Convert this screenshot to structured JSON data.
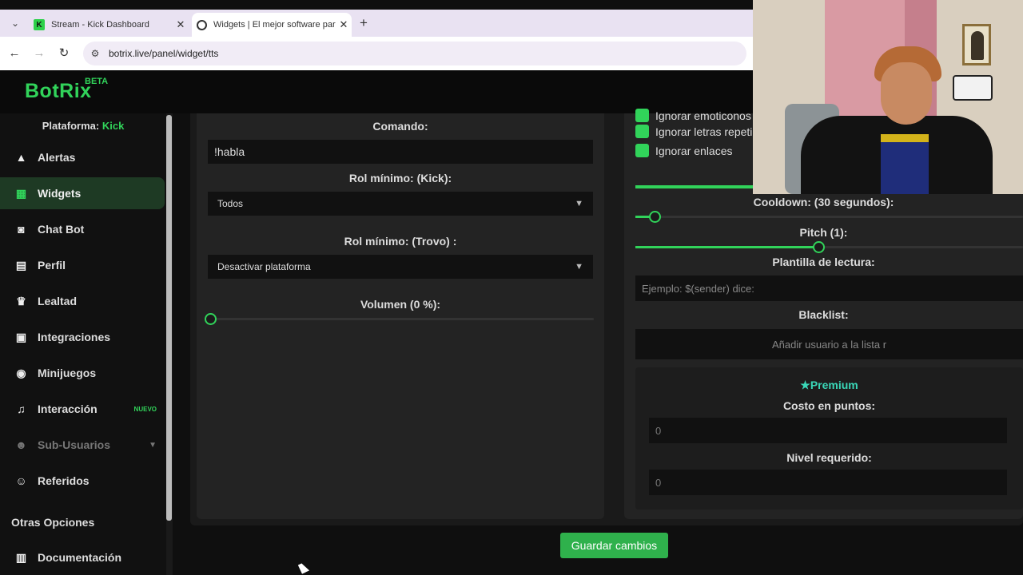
{
  "browser": {
    "tabs": [
      {
        "title": "Stream - Kick Dashboard",
        "favicon": "K"
      },
      {
        "title": "Widgets | El mejor software para",
        "favicon": ""
      }
    ],
    "url": "botrix.live/panel/widget/tts"
  },
  "app": {
    "logo": "BotRix",
    "logo_badge": "BETA",
    "platform_label": "Plataforma:",
    "platform_value": "Kick",
    "accent": "#31d35a"
  },
  "sidebar": {
    "items": [
      {
        "label": "Alertas",
        "icon": "warning-icon"
      },
      {
        "label": "Widgets",
        "icon": "grid-icon",
        "active": true
      },
      {
        "label": "Chat Bot",
        "icon": "robot-icon"
      },
      {
        "label": "Perfil",
        "icon": "id-card-icon"
      },
      {
        "label": "Lealtad",
        "icon": "trophy-icon"
      },
      {
        "label": "Integraciones",
        "icon": "puzzle-icon"
      },
      {
        "label": "Minijuegos",
        "icon": "gamepad-icon"
      },
      {
        "label": "Interacción",
        "icon": "music-icon",
        "badge": "NUEVO"
      },
      {
        "label": "Sub-Usuarios",
        "icon": "users-icon"
      },
      {
        "label": "Referidos",
        "icon": "user-group-icon"
      }
    ],
    "section_title": "Otras Opciones",
    "docs_label": "Documentación"
  },
  "left": {
    "command_label": "Comando:",
    "command_value": "!habla",
    "role_kick_label": "Rol mínimo: (Kick):",
    "role_kick_value": "Todos",
    "role_trovo_label": "Rol mínimo: (Trovo) :",
    "role_trovo_value": "Desactivar plataforma",
    "volume_label": "Volumen (0 %):",
    "volume_value": 0
  },
  "right": {
    "checks": [
      "Ignorar emoticonos",
      "Ignorar letras repetidas",
      "Ignorar enlaces"
    ],
    "cooldown_label": "Cooldown: (30 segundos):",
    "cooldown_value": 0.05,
    "pitch_label": "Pitch (1):",
    "pitch_value": 0.48,
    "template_label": "Plantilla de lectura:",
    "template_placeholder": "Ejemplo: $(sender) dice:",
    "blacklist_label": "Blacklist:",
    "blacklist_placeholder": "Añadir usuario a la lista r",
    "premium_title": "Premium",
    "cost_label": "Costo en puntos:",
    "cost_value": "0",
    "level_label": "Nivel requerido:",
    "level_value": "0"
  },
  "save_label": "Guardar cambios"
}
